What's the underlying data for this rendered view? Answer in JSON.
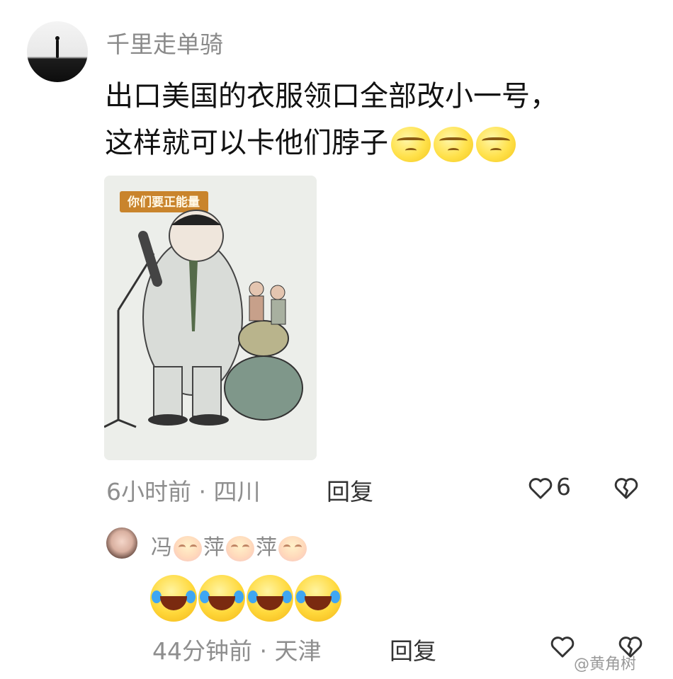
{
  "comment": {
    "username": "千里走单骑",
    "text_line1": "出口美国的衣服领口全部改小一号，",
    "text_line2": "这样就可以卡他们脖子",
    "emojis": [
      "annoyed-face-icon",
      "annoyed-face-icon",
      "annoyed-face-icon"
    ],
    "image_caption": "你们要正能量",
    "time": "6小时前",
    "location": "四川",
    "reply_label": "回复",
    "like_count": "6"
  },
  "reply": {
    "username_parts": [
      "冯",
      "萍",
      "萍"
    ],
    "emojis": [
      "crying-laughing-icon",
      "crying-laughing-icon",
      "crying-laughing-icon",
      "crying-laughing-icon"
    ],
    "time": "44分钟前",
    "location": "天津",
    "reply_label": "回复"
  },
  "watermark": "@黄角树",
  "separator": "·"
}
